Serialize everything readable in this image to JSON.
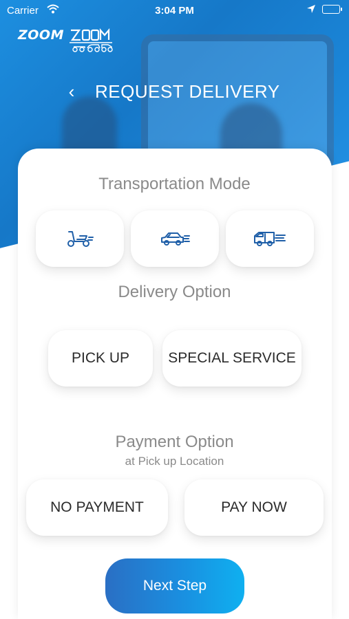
{
  "status_bar": {
    "carrier": "Carrier",
    "time": "3:04 PM"
  },
  "logo": {
    "word": "ZOOM"
  },
  "header": {
    "back_glyph": "‹",
    "title": "REQUEST DELIVERY"
  },
  "transportation": {
    "title": "Transportation Mode",
    "modes": [
      {
        "icon": "scooter-icon"
      },
      {
        "icon": "car-icon"
      },
      {
        "icon": "van-icon"
      }
    ]
  },
  "delivery": {
    "title": "Delivery Option",
    "options": [
      "PICK UP",
      "SPECIAL SERVICE"
    ]
  },
  "payment": {
    "title": "Payment Option",
    "subtitle": "at Pick up Location",
    "options": [
      "NO PAYMENT",
      "PAY NOW"
    ]
  },
  "next_button": {
    "label": "Next Step"
  },
  "colors": {
    "brand_blue": "#1a84d6",
    "icon_blue": "#1f5fa8",
    "text_gray": "#8a8a8a"
  }
}
